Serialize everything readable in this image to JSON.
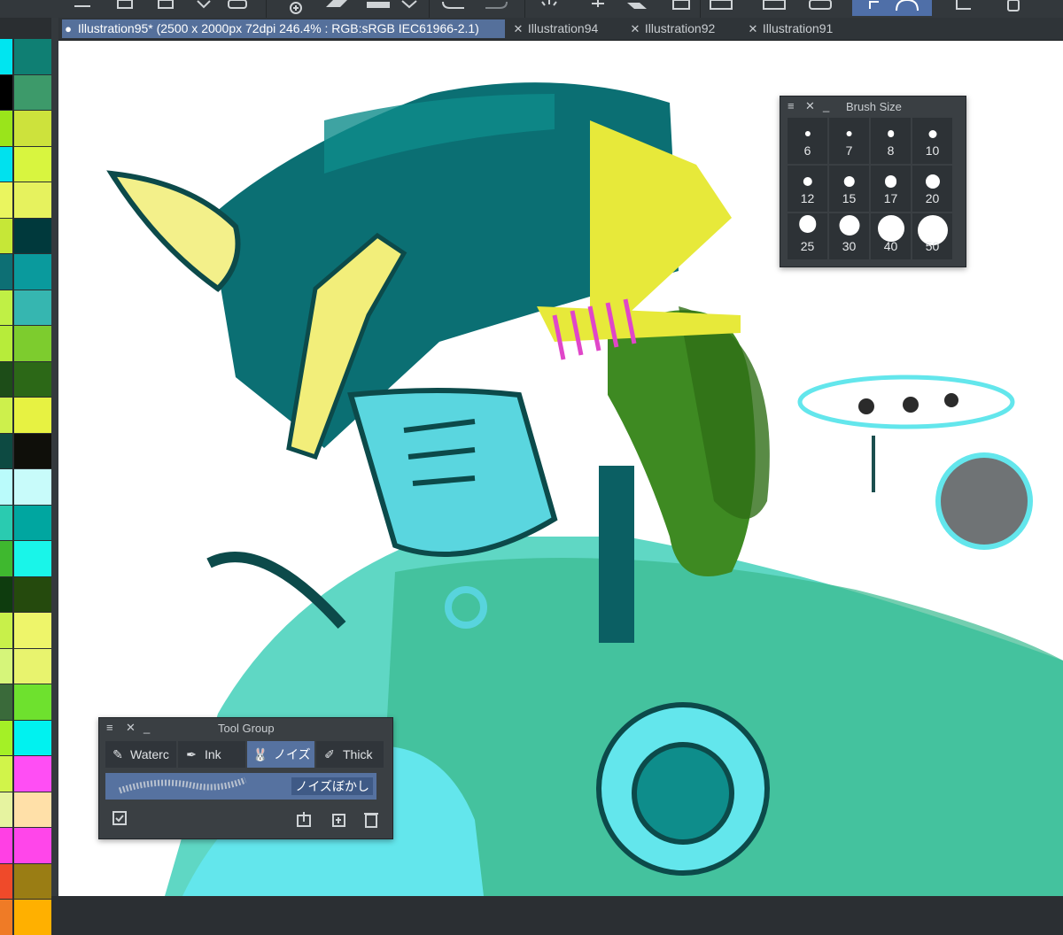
{
  "toolbar": {
    "icons": [
      "menu-icon",
      "frame-icon",
      "transform-icon",
      "chevron-down-icon",
      "new-layer-icon",
      "paste-icon",
      "chevron-down-icon",
      "undo-icon",
      "redo-icon",
      "loading-icon",
      "fill-icon",
      "chevron-down-icon",
      "select-icon",
      "lasso-icon",
      "ruler-icon",
      "phone-icon"
    ]
  },
  "tabs": [
    {
      "label": "Illustration95* (2500 x 2000px 72dpi 246.4% : RGB:sRGB IEC61966-2.1)",
      "active": true,
      "close": "●"
    },
    {
      "label": "Illustration94",
      "active": false,
      "close": "✕"
    },
    {
      "label": "Illustration92",
      "active": false,
      "close": "✕"
    },
    {
      "label": "Illustration91",
      "active": false,
      "close": "✕"
    }
  ],
  "palette": {
    "colors": [
      [
        "#00e5f0",
        "#0f7f73"
      ],
      [
        "#000000",
        "#3d9a6a"
      ],
      [
        "#9ae41b",
        "#cde23c"
      ],
      [
        "#00e1ee",
        "#d8f53f"
      ],
      [
        "#eaf55f",
        "#e6f25e"
      ],
      [
        "#c6e737",
        "#00393c"
      ],
      [
        "#0d6f74",
        "#0a9a9d"
      ],
      [
        "#c0f045",
        "#36b6b0"
      ],
      [
        "#b7ec3a",
        "#7dcc2e"
      ],
      [
        "#1d4d18",
        "#2c6817"
      ],
      [
        "#cdf04c",
        "#e7f242"
      ],
      [
        "#0d4a42",
        "#0f0f0a"
      ],
      [
        "#bafbfb",
        "#c8fbfa"
      ],
      [
        "#2acbb0",
        "#00a6a0"
      ],
      [
        "#3fb82f",
        "#19f5e9"
      ],
      [
        "#0e3c0e",
        "#254a0d"
      ],
      [
        "#c8f04a",
        "#eef56a"
      ],
      [
        "#d6f57a",
        "#e8f36e"
      ],
      [
        "#3a6a3a",
        "#6ee12e"
      ],
      [
        "#a4f026",
        "#00f2f0"
      ],
      [
        "#d1f44a",
        "#ff4ef4"
      ],
      [
        "#e6f3a0",
        "#ffe0a8"
      ],
      [
        "#ff40e4",
        "#ff46ea"
      ],
      [
        "#ef4a2a",
        "#9a7d14"
      ],
      [
        "#ef7b26",
        "#ffb000"
      ]
    ]
  },
  "brush_size": {
    "title": "Brush Size",
    "sizes": [
      "6",
      "7",
      "8",
      "10",
      "12",
      "15",
      "17",
      "20",
      "25",
      "30",
      "40",
      "50"
    ]
  },
  "tool_group": {
    "title": "Tool Group",
    "tabs": [
      {
        "label": "Waterc",
        "icon": "pencil-icon"
      },
      {
        "label": "Ink",
        "icon": "pen-nib-icon"
      },
      {
        "label": "ノイズ",
        "icon": "rabbit-icon"
      },
      {
        "label": "Thick",
        "icon": "marker-icon"
      }
    ],
    "selected_brush": "ノイズぼかし",
    "bottom_icons": [
      "select-all-icon",
      "import-icon",
      "duplicate-icon",
      "trash-icon"
    ]
  },
  "colors": {
    "toolbar_bg": "#33383c",
    "tab_active": "#55709b",
    "panel_bg": "#3a3f43",
    "accent": "#5672a0"
  }
}
